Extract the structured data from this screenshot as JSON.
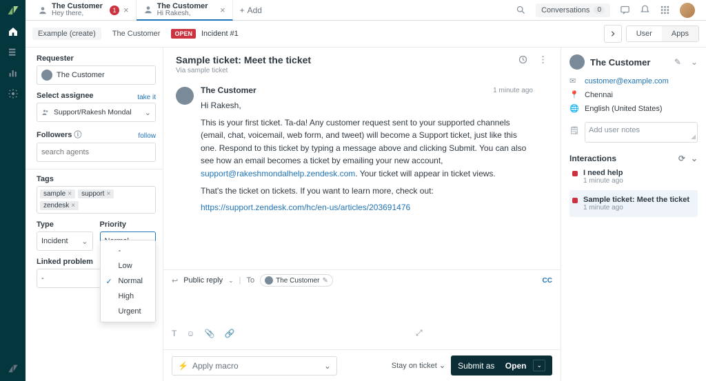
{
  "rail": {
    "items": [
      "home",
      "views",
      "reports",
      "admin"
    ]
  },
  "tabs": {
    "items": [
      {
        "title": "The Customer",
        "sub": "Hey there,",
        "badge": "1"
      },
      {
        "title": "The Customer",
        "sub": "Hi Rakesh,"
      }
    ],
    "add_label": "Add",
    "conversations_label": "Conversations",
    "conversations_count": "0"
  },
  "subhdr": {
    "crumb1": "Example (create)",
    "crumb2": "The Customer",
    "status": "OPEN",
    "incident": "Incident #1",
    "seg_user": "User",
    "seg_apps": "Apps"
  },
  "left": {
    "requester_label": "Requester",
    "requester_value": "The Customer",
    "assignee_label": "Select assignee",
    "assignee_take": "take it",
    "assignee_value": "Support/Rakesh Mondal",
    "followers_label": "Followers",
    "followers_follow": "follow",
    "followers_placeholder": "search agents",
    "tags_label": "Tags",
    "tags": [
      "sample",
      "support",
      "zendesk"
    ],
    "type_label": "Type",
    "type_value": "Incident",
    "priority_label": "Priority",
    "priority_value": "Normal",
    "priority_options": [
      "-",
      "Low",
      "Normal",
      "High",
      "Urgent"
    ],
    "linked_label": "Linked problem",
    "linked_value": "-"
  },
  "center": {
    "title": "Sample ticket: Meet the ticket",
    "via": "Via sample ticket",
    "msg_author": "The Customer",
    "msg_time": "1 minute ago",
    "greeting": "Hi Rakesh,",
    "body1a": "This is your first ticket. Ta-da! Any customer request sent to your supported channels (email, chat, voicemail, web form, and tweet) will become a Support ticket, just like this one. Respond to this ticket by typing a message above and clicking Submit. You can also see how an email becomes a ticket by emailing your new account, ",
    "body1_link": "support@rakeshmondalhelp.zendesk.com",
    "body1b": ". Your ticket will appear in ticket views.",
    "body2": "That's the ticket on tickets. If you want to learn more, check out:",
    "body_url": "https://support.zendesk.com/hc/en-us/articles/203691476",
    "reply_mode": "Public reply",
    "reply_to_label": "To",
    "reply_to_value": "The Customer",
    "cc_label": "CC",
    "macro_placeholder": "Apply macro",
    "stay_label": "Stay on ticket",
    "submit_label": "Submit as",
    "submit_status": "Open"
  },
  "right": {
    "name": "The Customer",
    "email": "customer@example.com",
    "location": "Chennai",
    "language": "English (United States)",
    "notes_placeholder": "Add user notes",
    "interactions_label": "Interactions",
    "items": [
      {
        "title": "I need help",
        "time": "1 minute ago"
      },
      {
        "title": "Sample ticket: Meet the ticket",
        "time": "1 minute ago"
      }
    ]
  }
}
